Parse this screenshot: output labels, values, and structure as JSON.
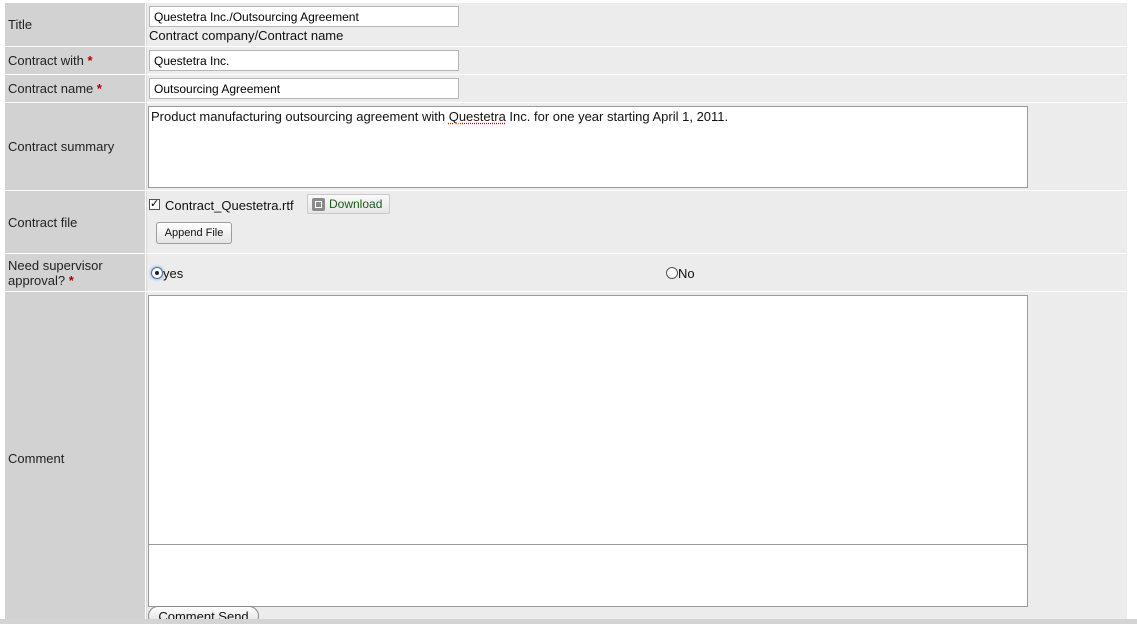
{
  "fields": {
    "title": {
      "label": "Title",
      "value": "Questetra Inc./Outsourcing Agreement",
      "hint": "Contract company/Contract name"
    },
    "contract_with": {
      "label": "Contract with",
      "required_mark": "*",
      "value": "Questetra Inc."
    },
    "contract_name": {
      "label": "Contract name",
      "required_mark": "*",
      "value": "Outsourcing Agreement"
    },
    "contract_summary": {
      "label": "Contract summary",
      "text_before": "Product manufacturing outsourcing agreement with ",
      "text_misspelled": "Questetra",
      "text_after": " Inc. for one year starting April 1, 2011."
    },
    "contract_file": {
      "label": "Contract file",
      "checkbox_mark": "✓",
      "file_name": "Contract_Questetra.rtf",
      "download_label": "Download",
      "append_label": "Append File"
    },
    "supervisor_approval": {
      "label": "Need supervisor approval?",
      "required_mark": "*",
      "options": [
        {
          "label": "yes",
          "selected": true
        },
        {
          "label": "No",
          "selected": false
        }
      ]
    },
    "comment": {
      "label": "Comment",
      "value": "",
      "send_label": "Comment Send"
    }
  },
  "colors": {
    "label_bg": "#d2d2d2",
    "value_bg": "#ececec",
    "required": "#b00000",
    "download_text": "#1c5a1c"
  }
}
